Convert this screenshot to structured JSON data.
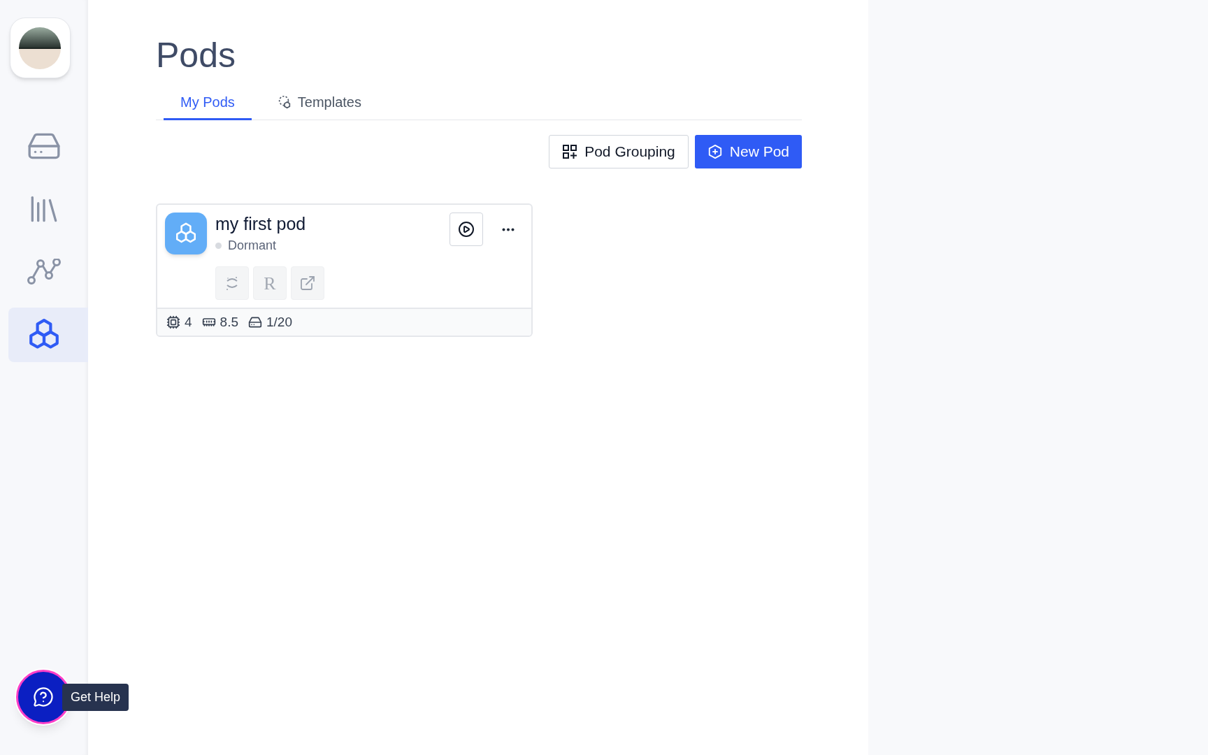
{
  "sidebar": {
    "items": [
      {
        "kind": "storage",
        "selected": false
      },
      {
        "kind": "library",
        "selected": false
      },
      {
        "kind": "graph",
        "selected": false
      },
      {
        "kind": "pods",
        "selected": true
      }
    ]
  },
  "page": {
    "title": "Pods"
  },
  "tabs": [
    {
      "label": "My Pods",
      "selected": true,
      "kind": "plain"
    },
    {
      "label": "Templates",
      "selected": false,
      "kind": "template"
    }
  ],
  "toolbar": {
    "buttons": [
      {
        "label": "Pod Grouping",
        "kind": "secondary"
      },
      {
        "label": "New Pod",
        "kind": "primary"
      }
    ]
  },
  "pods": [
    {
      "name": "my first pod",
      "status": "Dormant",
      "actions": [
        {
          "kind": "jupyter",
          "disabled": true
        },
        {
          "kind": "letter",
          "label": "R",
          "disabled": true
        },
        {
          "kind": "link",
          "disabled": true
        }
      ],
      "specs": [
        {
          "kind": "cpu",
          "value": "4"
        },
        {
          "kind": "memory",
          "value": "8.5"
        },
        {
          "kind": "disk",
          "value": "1/20"
        }
      ]
    }
  ],
  "help": {
    "tooltip": "Get Help"
  }
}
